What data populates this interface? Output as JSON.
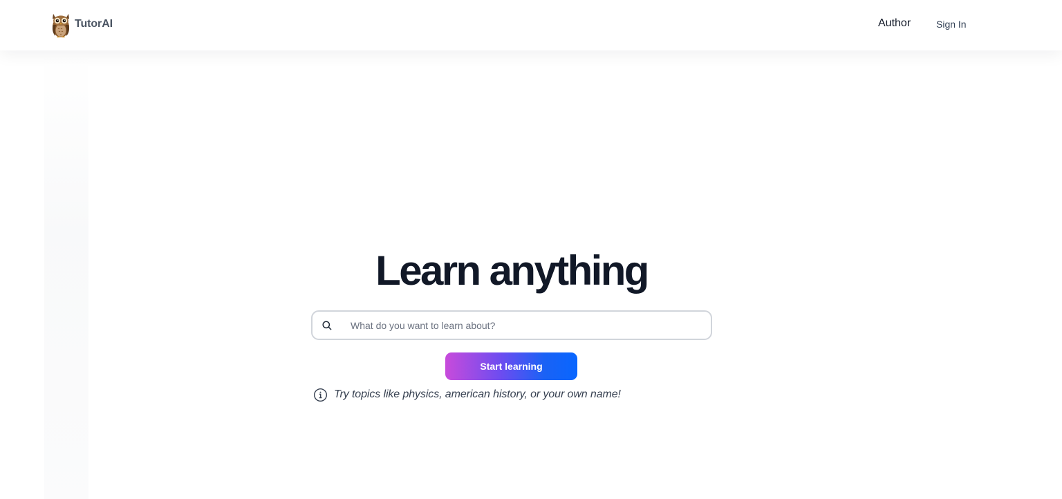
{
  "header": {
    "brand_name": "TutorAI",
    "logo_icon": "owl-icon",
    "nav": {
      "author_label": "Author",
      "signin_label": "Sign In"
    }
  },
  "hero": {
    "title": "Learn anything",
    "search": {
      "placeholder": "What do you want to learn about?",
      "value": "",
      "icon": "search-icon"
    },
    "start_button_label": "Start learning",
    "hint": {
      "icon": "info-icon",
      "text": "Try topics like physics, american history, or your own name!"
    }
  },
  "colors": {
    "title_text": "#111827",
    "button_gradient_start": "#c84bdb",
    "button_gradient_end": "#0866ff",
    "search_border": "#d1d5db",
    "brand_text": "#4b5563"
  }
}
